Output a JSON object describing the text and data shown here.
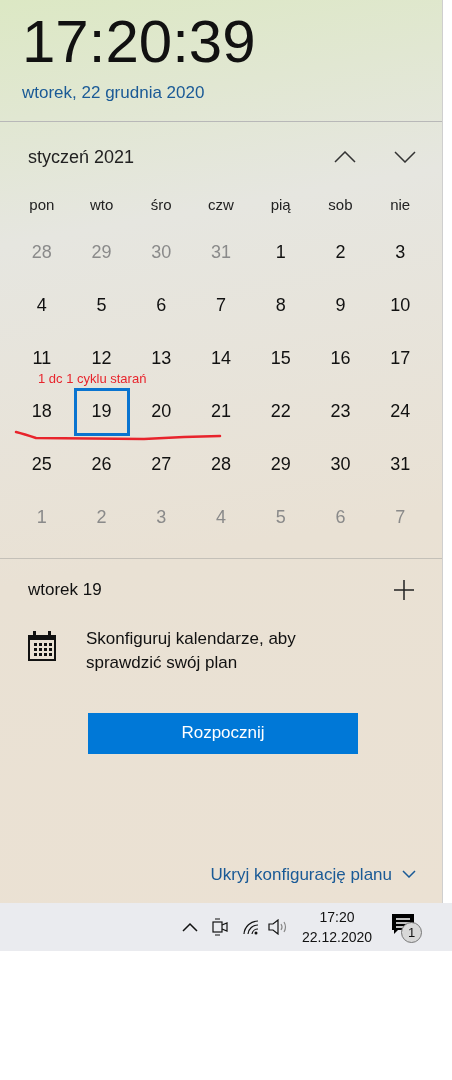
{
  "clock": {
    "time": "17:20:39",
    "date": "wtorek, 22 grudnia 2020"
  },
  "calendar": {
    "month": "styczeń 2021",
    "weekdays": [
      "pon",
      "wto",
      "śro",
      "czw",
      "pią",
      "sob",
      "nie"
    ],
    "weeks": [
      [
        {
          "label": "28",
          "dim": true,
          "selected": false
        },
        {
          "label": "29",
          "dim": true,
          "selected": false
        },
        {
          "label": "30",
          "dim": true,
          "selected": false
        },
        {
          "label": "31",
          "dim": true,
          "selected": false
        },
        {
          "label": "1",
          "dim": false,
          "selected": false
        },
        {
          "label": "2",
          "dim": false,
          "selected": false
        },
        {
          "label": "3",
          "dim": false,
          "selected": false
        }
      ],
      [
        {
          "label": "4",
          "dim": false,
          "selected": false
        },
        {
          "label": "5",
          "dim": false,
          "selected": false
        },
        {
          "label": "6",
          "dim": false,
          "selected": false
        },
        {
          "label": "7",
          "dim": false,
          "selected": false
        },
        {
          "label": "8",
          "dim": false,
          "selected": false
        },
        {
          "label": "9",
          "dim": false,
          "selected": false
        },
        {
          "label": "10",
          "dim": false,
          "selected": false
        }
      ],
      [
        {
          "label": "11",
          "dim": false,
          "selected": false
        },
        {
          "label": "12",
          "dim": false,
          "selected": false
        },
        {
          "label": "13",
          "dim": false,
          "selected": false
        },
        {
          "label": "14",
          "dim": false,
          "selected": false
        },
        {
          "label": "15",
          "dim": false,
          "selected": false
        },
        {
          "label": "16",
          "dim": false,
          "selected": false
        },
        {
          "label": "17",
          "dim": false,
          "selected": false
        }
      ],
      [
        {
          "label": "18",
          "dim": false,
          "selected": false
        },
        {
          "label": "19",
          "dim": false,
          "selected": true
        },
        {
          "label": "20",
          "dim": false,
          "selected": false
        },
        {
          "label": "21",
          "dim": false,
          "selected": false
        },
        {
          "label": "22",
          "dim": false,
          "selected": false
        },
        {
          "label": "23",
          "dim": false,
          "selected": false
        },
        {
          "label": "24",
          "dim": false,
          "selected": false
        }
      ],
      [
        {
          "label": "25",
          "dim": false,
          "selected": false
        },
        {
          "label": "26",
          "dim": false,
          "selected": false
        },
        {
          "label": "27",
          "dim": false,
          "selected": false
        },
        {
          "label": "28",
          "dim": false,
          "selected": false
        },
        {
          "label": "29",
          "dim": false,
          "selected": false
        },
        {
          "label": "30",
          "dim": false,
          "selected": false
        },
        {
          "label": "31",
          "dim": false,
          "selected": false
        }
      ],
      [
        {
          "label": "1",
          "dim": true,
          "selected": false
        },
        {
          "label": "2",
          "dim": true,
          "selected": false
        },
        {
          "label": "3",
          "dim": true,
          "selected": false
        },
        {
          "label": "4",
          "dim": true,
          "selected": false
        },
        {
          "label": "5",
          "dim": true,
          "selected": false
        },
        {
          "label": "6",
          "dim": true,
          "selected": false
        },
        {
          "label": "7",
          "dim": true,
          "selected": false
        }
      ]
    ],
    "annotation": "1 dc 1 cyklu starań"
  },
  "agenda": {
    "day": "wtorek 19",
    "message": "Skonfiguruj kalendarze, aby sprawdzić swój plan",
    "button": "Rozpocznij",
    "toggle": "Ukryj konfigurację planu"
  },
  "taskbar": {
    "time": "17:20",
    "date": "22.12.2020",
    "notifications": "1"
  }
}
